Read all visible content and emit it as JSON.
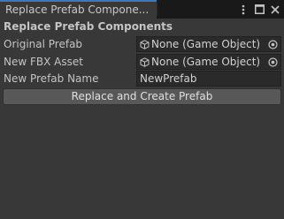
{
  "window": {
    "tab_title": "Replace Prefab Compone...",
    "controls": [
      "more-icon",
      "maximize-icon",
      "close-icon"
    ]
  },
  "panel": {
    "header": "Replace Prefab Components",
    "fields": [
      {
        "label": "Original Prefab",
        "value": "None (Game Object)",
        "icon": "cube-icon",
        "picker_icon": "object-picker-icon"
      },
      {
        "label": "New FBX Asset",
        "value": "None (Game Object)",
        "icon": "cube-icon",
        "picker_icon": "object-picker-icon"
      },
      {
        "label": "New Prefab Name",
        "value": "NewPrefab"
      }
    ],
    "button_label": "Replace and Create Prefab"
  }
}
